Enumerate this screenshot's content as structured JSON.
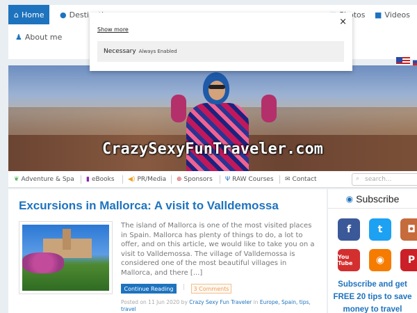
{
  "topnav": {
    "items": [
      {
        "label": "Home",
        "icon": "home-icon"
      },
      {
        "label": "Destinations",
        "icon": "globe-icon"
      },
      {
        "label": "Photos",
        "icon": "photo-icon"
      },
      {
        "label": "Videos",
        "icon": "video-icon"
      },
      {
        "label": "About me",
        "icon": "person-icon"
      }
    ],
    "accent": "#1e73be"
  },
  "cookie": {
    "show_more": "Show more",
    "category": "Necessary",
    "category_status": "Always Enabled",
    "close": "×"
  },
  "hero": {
    "title": "CrazySexyFunTraveler.com"
  },
  "subnav": {
    "items": [
      {
        "label": "Adventure & Spa",
        "icon": "leaf-icon"
      },
      {
        "label": "eBooks",
        "icon": "book-icon"
      },
      {
        "label": "PR/Media",
        "icon": "megaphone-icon"
      },
      {
        "label": "Sponsors",
        "icon": "lifebuoy-icon"
      },
      {
        "label": "RAW Courses",
        "icon": "utensils-icon"
      },
      {
        "label": "Contact",
        "icon": "envelope-icon"
      }
    ],
    "search_placeholder": "search..."
  },
  "post": {
    "title": "Excursions in Mallorca: A visit to Valldemossa",
    "excerpt": "The island of Mallorca is one of the most visited places in Spain. Mallorca has plenty of things to do, a lot to offer, and on this article, we would like to take you on a visit to Valldemossa. The village of Valldemossa is considered one of the most beautiful villages in Mallorca, and there [...]",
    "read_more": "Continue Reading",
    "comments": "3 Comments",
    "meta_prefix": "Posted on 11 Jun 2020 by",
    "author": "Crazy Sexy Fun Traveler",
    "meta_in": "in",
    "categories": "Europe, Spain, tips, travel"
  },
  "sidebar": {
    "subscribe_title": "Subscribe",
    "promo_line1": "Subscribe and get",
    "promo_line2": "FREE 20 tips to save",
    "promo_line3": "money to travel",
    "social": [
      {
        "name": "facebook",
        "glyph": "f"
      },
      {
        "name": "twitter",
        "glyph": "t"
      },
      {
        "name": "instagram",
        "glyph": "◘"
      },
      {
        "name": "youtube",
        "glyph": "You Tube"
      },
      {
        "name": "rss",
        "glyph": "◉"
      },
      {
        "name": "pinterest",
        "glyph": "P"
      }
    ]
  }
}
